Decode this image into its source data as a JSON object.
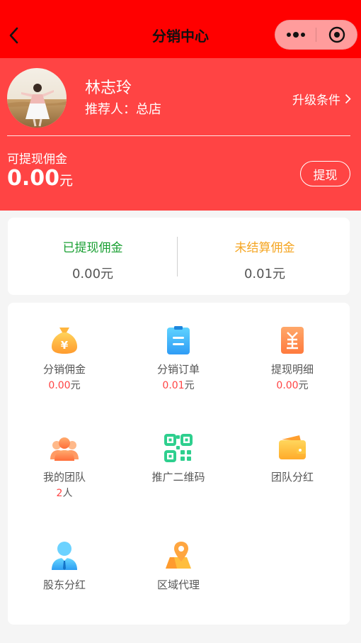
{
  "nav": {
    "title": "分销中心"
  },
  "profile": {
    "name": "林志玲",
    "referrer": "推荐人：总店",
    "upgrade_label": "升级条件",
    "withdrawable_label": "可提现佣金",
    "withdrawable_amount": "0.00",
    "currency_unit": "元",
    "withdraw_button": "提现"
  },
  "summary": {
    "withdrawn_label": "已提现佣金",
    "withdrawn_value": "0.00元",
    "unsettled_label": "未结算佣金",
    "unsettled_value": "0.01元"
  },
  "grid": {
    "items": [
      {
        "label": "分销佣金",
        "value": "0.00",
        "unit": "元",
        "icon": "money-bag-icon"
      },
      {
        "label": "分销订单",
        "value": "0.01",
        "unit": "元",
        "icon": "clipboard-icon"
      },
      {
        "label": "提现明细",
        "value": "0.00",
        "unit": "元",
        "icon": "yen-document-icon"
      },
      {
        "label": "我的团队",
        "value": "2",
        "unit": "人",
        "icon": "team-icon"
      },
      {
        "label": "推广二维码",
        "icon": "qr-code-icon"
      },
      {
        "label": "团队分红",
        "icon": "wallet-icon"
      },
      {
        "label": "股东分红",
        "icon": "shareholder-icon"
      },
      {
        "label": "区域代理",
        "icon": "map-pin-icon"
      }
    ]
  },
  "colors": {
    "nav_bg": "#ff0000",
    "header_bg": "#ff4444",
    "withdrawn_green": "#1aa033",
    "unsettled_orange": "#f5a623",
    "value_red": "#ff4444"
  }
}
